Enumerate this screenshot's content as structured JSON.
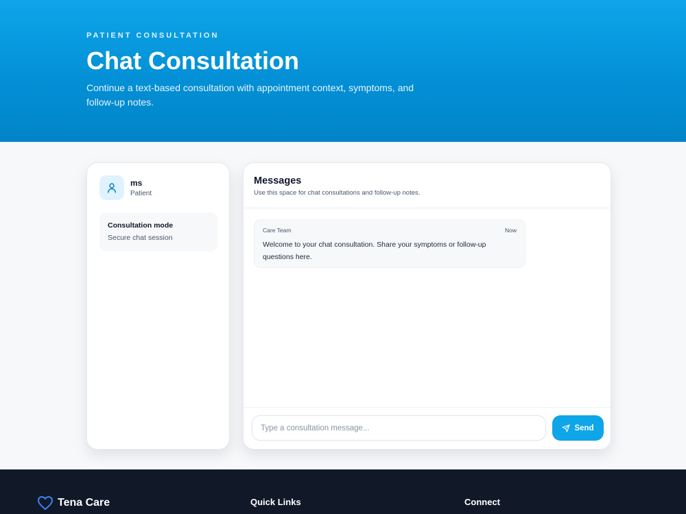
{
  "hero": {
    "eyebrow": "PATIENT CONSULTATION",
    "title": "Chat Consultation",
    "subtitle": "Continue a text-based consultation with appointment context, symptoms, and follow-up notes."
  },
  "sidebar": {
    "user_name": "ms",
    "user_role": "Patient",
    "mode_title": "Consultation mode",
    "mode_value": "Secure chat session"
  },
  "chat": {
    "title": "Messages",
    "subtitle": "Use this space for chat consultations and follow-up notes.",
    "messages": [
      {
        "sender": "Care Team",
        "time": "Now",
        "text": "Welcome to your chat consultation. Share your symptoms or follow-up questions here."
      }
    ],
    "input": {
      "placeholder": "Type a consultation message...",
      "value": ""
    },
    "send_label": "Send"
  },
  "footer": {
    "brand": "Tena Care",
    "quick_links": "Quick Links",
    "connect": "Connect"
  },
  "colors": {
    "primary": "#0ea5e9",
    "hero_dark": "#0284c7",
    "footer_bg": "#111827",
    "brand_icon": "#3b82f6"
  },
  "icons": {
    "avatar": "user-icon",
    "send": "send-icon",
    "brand": "heart-icon"
  }
}
